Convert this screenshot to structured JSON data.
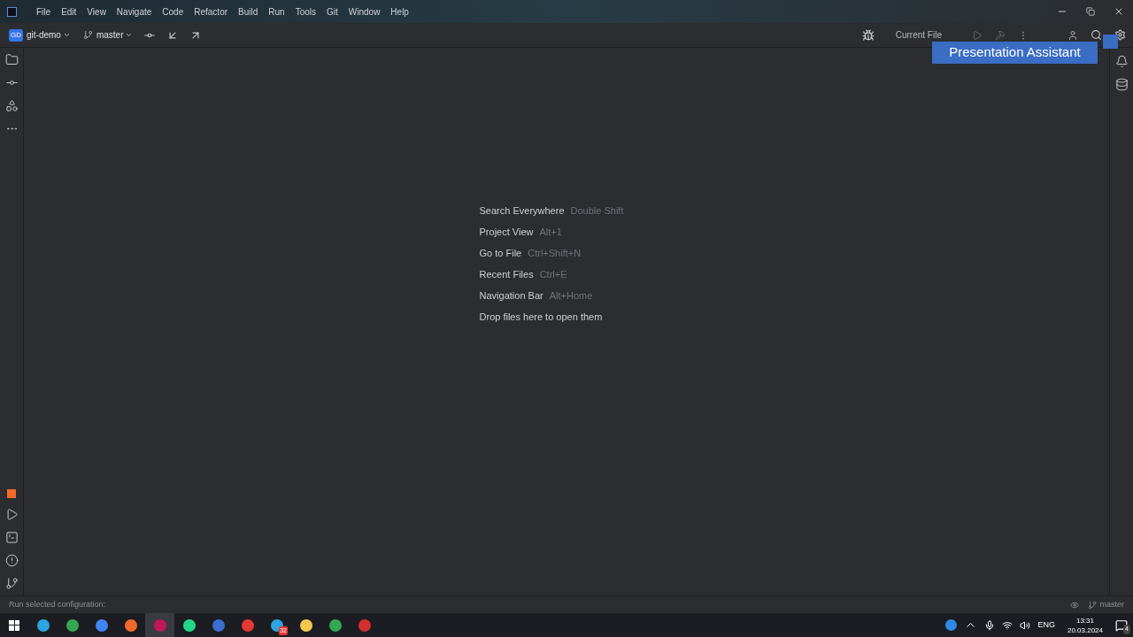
{
  "menu": [
    "File",
    "Edit",
    "View",
    "Navigate",
    "Code",
    "Refactor",
    "Build",
    "Run",
    "Tools",
    "Git",
    "Window",
    "Help"
  ],
  "toolbar": {
    "project_badge": "GD",
    "project": "git-demo",
    "branch": "master",
    "run_config": "Current File"
  },
  "popup": {
    "title": "Presentation Assistant"
  },
  "hints": [
    {
      "action": "Search Everywhere",
      "shortcut": "Double Shift"
    },
    {
      "action": "Project View",
      "shortcut": "Alt+1"
    },
    {
      "action": "Go to File",
      "shortcut": "Ctrl+Shift+N"
    },
    {
      "action": "Recent Files",
      "shortcut": "Ctrl+E"
    },
    {
      "action": "Navigation Bar",
      "shortcut": "Alt+Home"
    },
    {
      "action": "Drop files here to open them"
    }
  ],
  "status_bar": {
    "message": "Run selected configuration:",
    "branch": "master"
  },
  "taskbar": {
    "apps": [
      {
        "color": "#2ca5e0",
        "selected": false
      },
      {
        "color": "#34a853",
        "selected": false
      },
      {
        "color": "#4285f4",
        "selected": false
      },
      {
        "color": "#f26b2a",
        "selected": false
      },
      {
        "color": "#c2185b",
        "selected": true
      },
      {
        "color": "#21d789",
        "selected": false
      },
      {
        "color": "#3b6fd1",
        "selected": false
      },
      {
        "color": "#e53935",
        "selected": false
      },
      {
        "color": "#2ca5e0",
        "selected": false,
        "badge": "32"
      },
      {
        "color": "#f2c94c",
        "selected": false
      },
      {
        "color": "#34a853",
        "selected": false
      },
      {
        "color": "#d32f2f",
        "selected": false
      }
    ],
    "language": "ENG",
    "time": "13:31",
    "date": "20.03.2024",
    "notifications": "4"
  }
}
